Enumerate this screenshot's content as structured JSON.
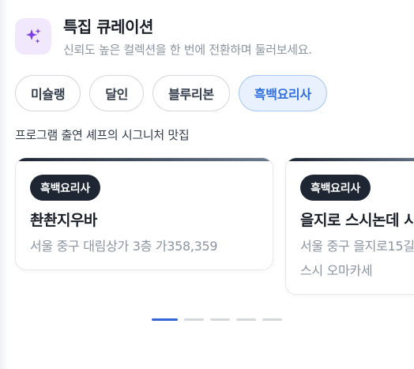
{
  "header": {
    "icon": "sparkles-icon",
    "icon_color": "#7b3fe4",
    "title": "특집 큐레이션",
    "subtitle": "신뢰도 높은 컬렉션을 한 번에 전환하며 둘러보세요."
  },
  "tabs": [
    {
      "label": "미슐랭",
      "active": false
    },
    {
      "label": "달인",
      "active": false
    },
    {
      "label": "블루리본",
      "active": false
    },
    {
      "label": "흑백요리사",
      "active": true
    }
  ],
  "section": {
    "label": "프로그램 출연 셰프의 시그니처 맛집"
  },
  "cards": [
    {
      "badge": "흑백요리사",
      "title": "촨촨지우바",
      "address": "서울 중구 대림상가 3층 가358,359",
      "category": ""
    },
    {
      "badge": "흑백요리사",
      "title": "을지로 스시논데 시",
      "address": "서울 중구 을지로15길",
      "category": "스시 오마카세"
    }
  ],
  "pager": {
    "count": 5,
    "active_index": 0
  },
  "colors": {
    "accent": "#3565d8",
    "active_tab_bg": "#e8f1fd",
    "badge_bg": "#1e2634"
  }
}
